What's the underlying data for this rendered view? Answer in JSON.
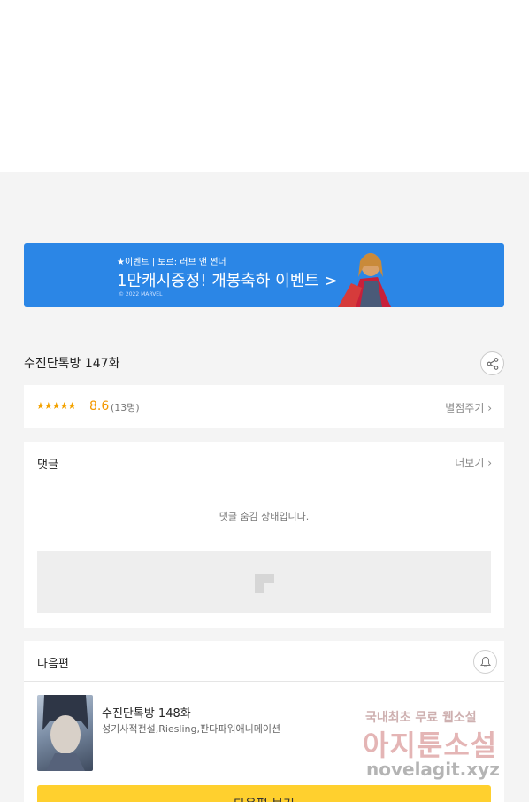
{
  "banner": {
    "tag": "★이벤트 | 토르: 러브 앤 썬더",
    "headline": "1만캐시증정! 개봉축하 이벤트 >",
    "copyright": "© 2022 MARVEL"
  },
  "episode": {
    "title": "수진단톡방 147화"
  },
  "rating": {
    "stars": "★★★★★",
    "score": "8.6",
    "count": "(13명)",
    "rate_label": "별점주기 ›"
  },
  "comments": {
    "label": "댓글",
    "more_label": "더보기 ›",
    "hidden_message": "댓글 숨김 상태입니다."
  },
  "next": {
    "label": "다음편",
    "title": "수진단톡방 148화",
    "meta": "성기사적전설,Riesling,판다파워애니메이션",
    "button_label": "다음편 보기"
  },
  "watermark": {
    "line1": "국내최초 무료 웹소설",
    "line2": "아지툰소설",
    "line3": "novelagit.xyz"
  },
  "colors": {
    "banner_bg": "#2b86e6",
    "star": "#f3a200",
    "next_button": "#ffd02e"
  }
}
